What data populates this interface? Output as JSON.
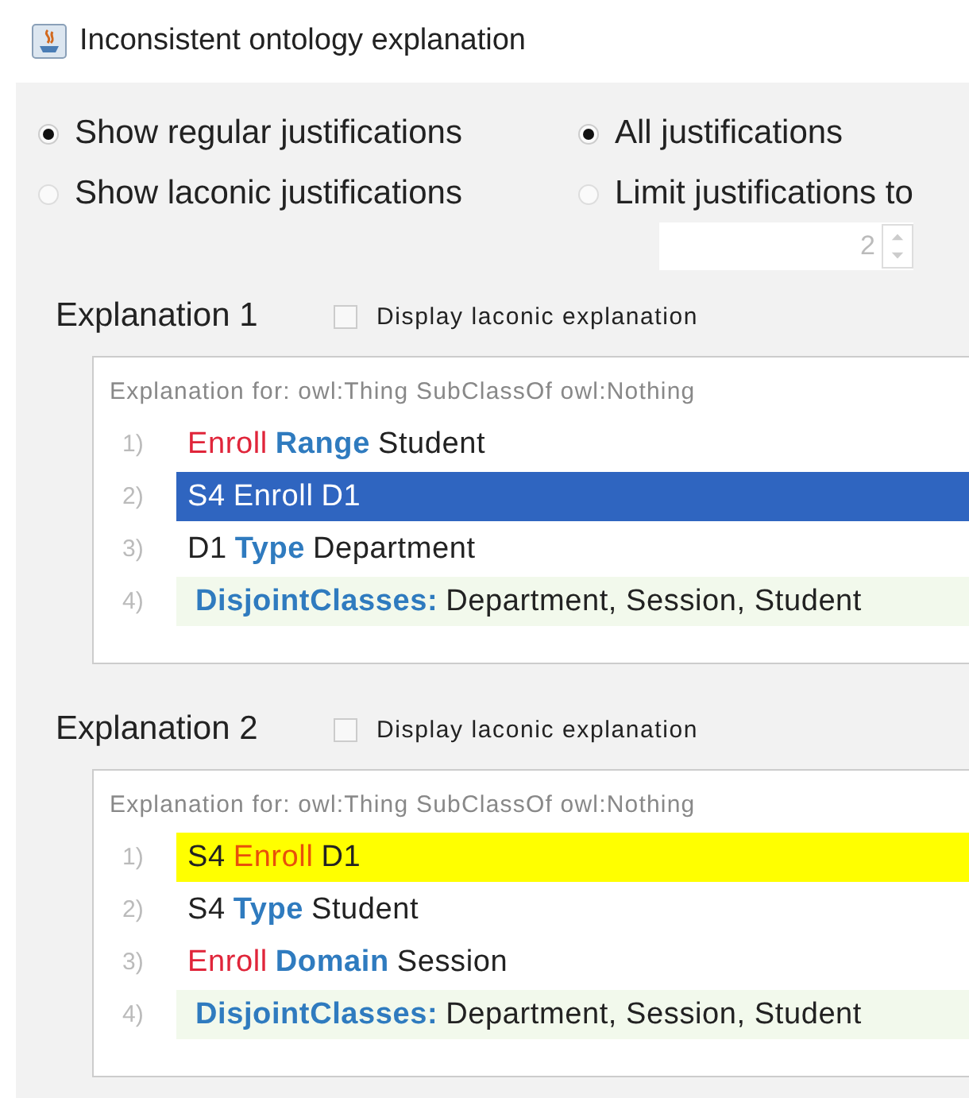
{
  "window": {
    "title": "Inconsistent ontology explanation"
  },
  "justification_type": [
    {
      "label": "Show regular justifications",
      "selected": true
    },
    {
      "label": "Show laconic justifications",
      "selected": false
    }
  ],
  "justification_limit": [
    {
      "label": "All justifications",
      "selected": true
    },
    {
      "label": "Limit justifications to",
      "selected": false
    }
  ],
  "limit_field": {
    "value": "2",
    "disabled": true
  },
  "explanations": [
    {
      "title": "Explanation 1",
      "laconic_label": "Display laconic explanation",
      "laconic_checked": false,
      "header": "Explanation for: owl:Thing SubClassOf owl:Nothing",
      "axioms": [
        {
          "number": "1)",
          "kind": "assertion",
          "selected": false,
          "highlighted": false,
          "tokens": [
            {
              "text": "Enroll",
              "kind": "property"
            },
            {
              "text": "Range",
              "kind": "keyword"
            },
            {
              "text": "Student",
              "kind": "name"
            }
          ]
        },
        {
          "number": "2)",
          "kind": "assertion",
          "selected": true,
          "highlighted": false,
          "tokens": [
            {
              "text": "S4",
              "kind": "name"
            },
            {
              "text": "Enroll",
              "kind": "property"
            },
            {
              "text": "D1",
              "kind": "name"
            }
          ]
        },
        {
          "number": "3)",
          "kind": "assertion",
          "selected": false,
          "highlighted": false,
          "tokens": [
            {
              "text": "D1",
              "kind": "name"
            },
            {
              "text": "Type",
              "kind": "keyword"
            },
            {
              "text": "Department",
              "kind": "name"
            }
          ]
        },
        {
          "number": "4)",
          "kind": "disjoint",
          "selected": false,
          "highlighted": false,
          "tokens": [
            {
              "text": "DisjointClasses:",
              "kind": "keyword"
            },
            {
              "text": "Department, Session, Student",
              "kind": "name"
            }
          ]
        }
      ]
    },
    {
      "title": "Explanation 2",
      "laconic_label": "Display laconic explanation",
      "laconic_checked": false,
      "header": "Explanation for: owl:Thing SubClassOf owl:Nothing",
      "axioms": [
        {
          "number": "1)",
          "kind": "assertion",
          "selected": false,
          "highlighted": true,
          "tokens": [
            {
              "text": "S4",
              "kind": "name"
            },
            {
              "text": "Enroll",
              "kind": "property"
            },
            {
              "text": "D1",
              "kind": "name"
            }
          ]
        },
        {
          "number": "2)",
          "kind": "assertion",
          "selected": false,
          "highlighted": false,
          "tokens": [
            {
              "text": "S4",
              "kind": "name"
            },
            {
              "text": "Type",
              "kind": "keyword"
            },
            {
              "text": "Student",
              "kind": "name"
            }
          ]
        },
        {
          "number": "3)",
          "kind": "assertion",
          "selected": false,
          "highlighted": false,
          "tokens": [
            {
              "text": "Enroll",
              "kind": "property"
            },
            {
              "text": "Domain",
              "kind": "keyword"
            },
            {
              "text": "Session",
              "kind": "name"
            }
          ]
        },
        {
          "number": "4)",
          "kind": "disjoint",
          "selected": false,
          "highlighted": false,
          "tokens": [
            {
              "text": "DisjointClasses:",
              "kind": "keyword"
            },
            {
              "text": "Department, Session, Student",
              "kind": "name"
            }
          ]
        }
      ]
    }
  ]
}
